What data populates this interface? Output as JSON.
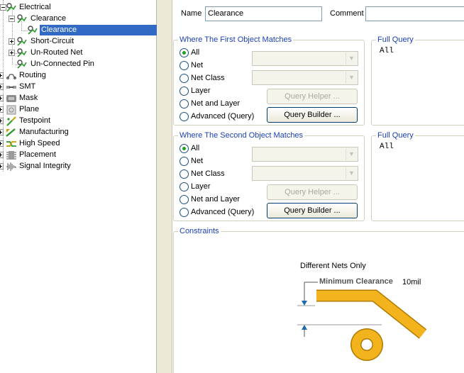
{
  "tree": {
    "items": [
      {
        "label": "Electrical",
        "icon": "electrical-rule-icon"
      },
      {
        "label": "Clearance",
        "icon": "clearance-rule-icon"
      },
      {
        "label": "Clearance",
        "icon": "clearance-rule-icon",
        "selected": true
      },
      {
        "label": "Short-Circuit",
        "icon": "short-circuit-rule-icon"
      },
      {
        "label": "Un-Routed Net",
        "icon": "un-routed-net-rule-icon"
      },
      {
        "label": "Un-Connected Pin",
        "icon": "un-connected-pin-rule-icon"
      },
      {
        "label": "Routing",
        "icon": "routing-rule-icon"
      },
      {
        "label": "SMT",
        "icon": "smt-rule-icon"
      },
      {
        "label": "Mask",
        "icon": "mask-rule-icon"
      },
      {
        "label": "Plane",
        "icon": "plane-rule-icon"
      },
      {
        "label": "Testpoint",
        "icon": "testpoint-rule-icon"
      },
      {
        "label": "Manufacturing",
        "icon": "manufacturing-rule-icon"
      },
      {
        "label": "High Speed",
        "icon": "high-speed-rule-icon"
      },
      {
        "label": "Placement",
        "icon": "placement-rule-icon"
      },
      {
        "label": "Signal Integrity",
        "icon": "signal-integrity-rule-icon"
      }
    ]
  },
  "rule": {
    "name_label": "Name",
    "name_value": "Clearance",
    "comment_label": "Comment",
    "comment_value": ""
  },
  "first_match": {
    "title": "Where The First Object Matches",
    "options": [
      "All",
      "Net",
      "Net Class",
      "Layer",
      "Net and Layer",
      "Advanced (Query)"
    ],
    "selected": "All",
    "query_helper_label": "Query Helper ...",
    "query_builder_label": "Query Builder ...",
    "full_query_title": "Full Query",
    "full_query": "All"
  },
  "second_match": {
    "title": "Where The Second Object Matches",
    "options": [
      "All",
      "Net",
      "Net Class",
      "Layer",
      "Net and Layer",
      "Advanced (Query)"
    ],
    "selected": "All",
    "query_helper_label": "Query Helper ...",
    "query_builder_label": "Query Builder ...",
    "full_query_title": "Full Query",
    "full_query": "All"
  },
  "constraints": {
    "title": "Constraints",
    "scope": "Different Nets Only",
    "min_clearance_label": "Minimum Clearance",
    "min_clearance_value": "10mil",
    "colors": {
      "copper": "#f2b31c",
      "copper_edge": "#b07a00",
      "arrow": "#1b6bb0"
    }
  }
}
